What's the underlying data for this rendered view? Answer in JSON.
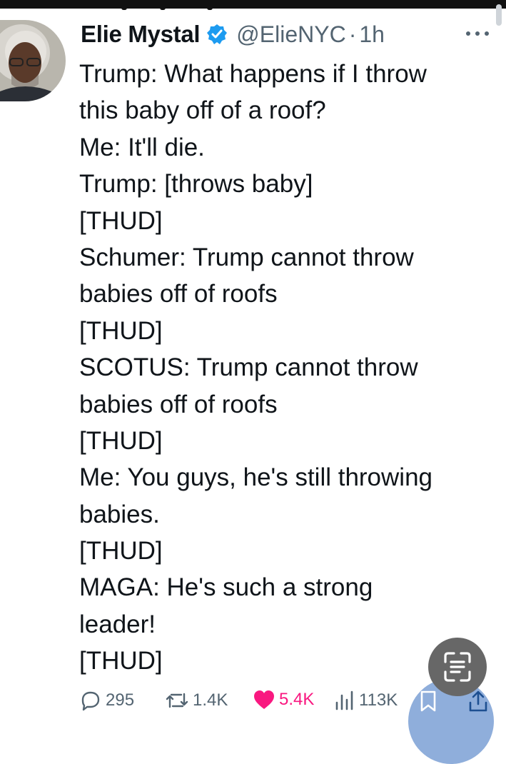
{
  "author": {
    "name": "Elie Mystal",
    "handle": "@ElieNYC",
    "separator": "·",
    "time": "1h",
    "verified_icon": "verified-badge-icon",
    "verified_color": "#1d9bf0"
  },
  "tweet": {
    "lines": [
      "Trump: What happens if I throw",
      "this baby off of a roof?",
      "Me: It'll die.",
      "Trump: [throws baby]",
      "[THUD]",
      "Schumer: Trump cannot throw",
      "babies off of roofs",
      "[THUD]",
      "SCOTUS: Trump cannot throw",
      "babies off of roofs",
      "[THUD]",
      "Me: You guys, he's still throwing",
      "babies.",
      "[THUD]",
      "MAGA: He's such a strong",
      "leader!",
      "[THUD]"
    ]
  },
  "actions": {
    "replies": "295",
    "reposts": "1.4K",
    "likes": "5.4K",
    "views": "113K",
    "like_color": "#f91880",
    "muted_color": "#536471"
  },
  "icons": {
    "more": "more-icon",
    "reply": "reply-icon",
    "repost": "repost-icon",
    "like": "heart-icon",
    "views": "views-icon",
    "bookmark": "bookmark-icon",
    "share": "share-icon",
    "scan": "scan-text-icon"
  }
}
